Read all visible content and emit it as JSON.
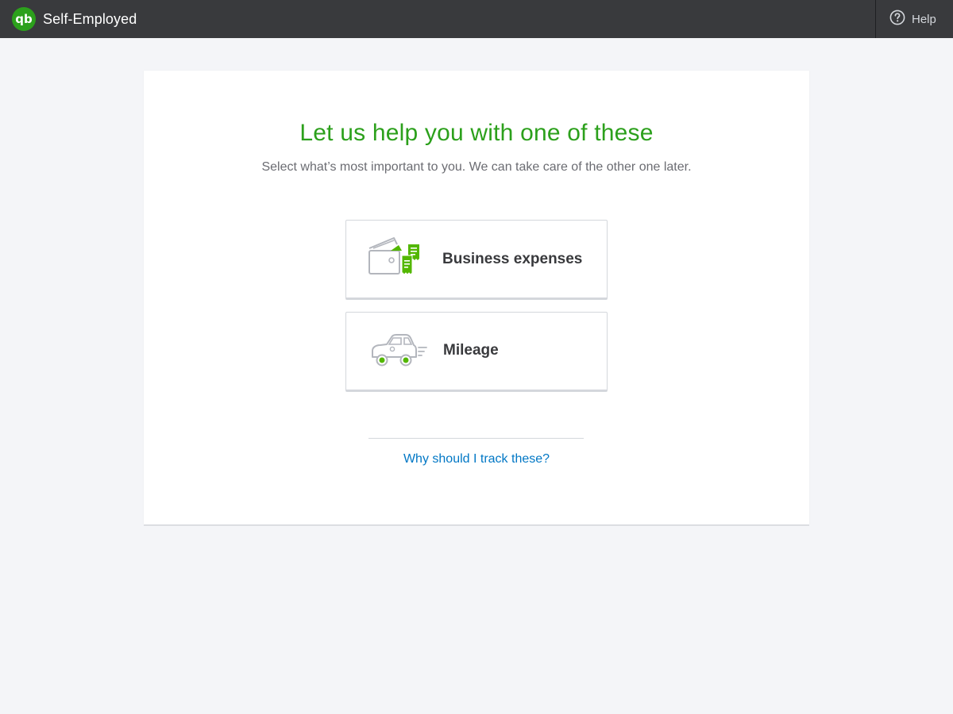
{
  "header": {
    "app_name": "Self-Employed",
    "logo_text": "qb",
    "help_label": "Help"
  },
  "main": {
    "title": "Let us help you with one of these",
    "subtitle": "Select what’s most important to you. We can take care of the other one later.",
    "options": [
      {
        "label": "Business expenses",
        "icon": "wallet-receipts-icon"
      },
      {
        "label": "Mileage",
        "icon": "car-icon"
      }
    ],
    "why_link": "Why should I track these?"
  },
  "colors": {
    "topbar": "#393a3d",
    "brand_green": "#2ca01c",
    "link_blue": "#0077c5",
    "background": "#f4f5f8"
  }
}
